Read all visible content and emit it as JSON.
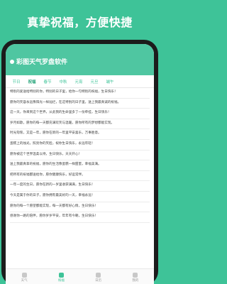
{
  "headline": "真挚祝福，方便快捷",
  "app": {
    "title": "彩图天气罗盘软件"
  },
  "tabs": [
    "节日",
    "祝福",
    "春节",
    "中秋",
    "元宵",
    "元旦",
    "端午"
  ],
  "messages": [
    "特别的爱送给特别的你，特别的日子里，给你一句特别的祝福，生日快乐！",
    "愿你的笑容永远像阳光一样灿烂，在这特别的日子里，送上我最真诚的祝福。",
    "这一天，你来到这个世界，从此我的生命里多了一份牵挂，生日快乐！",
    "岁月如歌，愿你的每一天都充满欢笑与温暖，愿你所有的梦想都能实现。",
    "时光匆匆，又是一年，愿你在新的一年里平安喜乐，万事胜意。",
    "蛋糕上的烛光，照亮你的笑脸，祝你生日快乐，永远年轻！",
    "愿你被这个世界温柔以待，生日快乐，天天开心！",
    "送上我最真挚的祝福，愿你的生活像蛋糕一样甜蜜，幸福美满。",
    "把所有的祝福都送给你，愿你健康快乐，好运常伴。",
    "一年一度的生日，愿你在新的一岁里收获满满，生日快乐！",
    "今天是属于你的日子，愿你拥有最美好的一天，幸福永远！",
    "愿你的每一个愿望都能实现，每一天都有好心情，生日快乐！",
    "感谢你一路的陪伴，愿你岁岁平安，年年有今朝，生日快乐！"
  ],
  "nav": [
    {
      "label": "天气",
      "active": false
    },
    {
      "label": "祝福",
      "active": true
    },
    {
      "label": "日历",
      "active": false
    },
    {
      "label": "我的",
      "active": false
    }
  ]
}
